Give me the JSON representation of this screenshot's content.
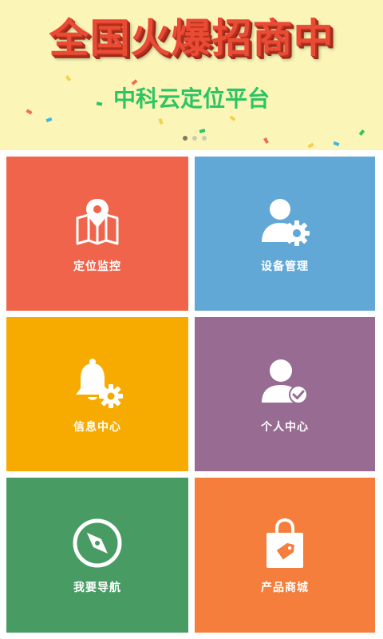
{
  "banner": {
    "title": "全国火爆招商中",
    "subtitle": "中科云定位平台",
    "pager": {
      "count": 3,
      "active": 0
    }
  },
  "tiles": [
    {
      "label": "定位监控",
      "color": "#ef644b",
      "icon": "map-pin-icon"
    },
    {
      "label": "设备管理",
      "color": "#61a8d7",
      "icon": "user-settings-icon"
    },
    {
      "label": "信息中心",
      "color": "#f7ab00",
      "icon": "bell-settings-icon"
    },
    {
      "label": "个人中心",
      "color": "#976b92",
      "icon": "user-check-icon"
    },
    {
      "label": "我要导航",
      "color": "#479b63",
      "icon": "compass-icon"
    },
    {
      "label": "产品商城",
      "color": "#f57e3d",
      "icon": "shopping-bag-icon"
    }
  ]
}
